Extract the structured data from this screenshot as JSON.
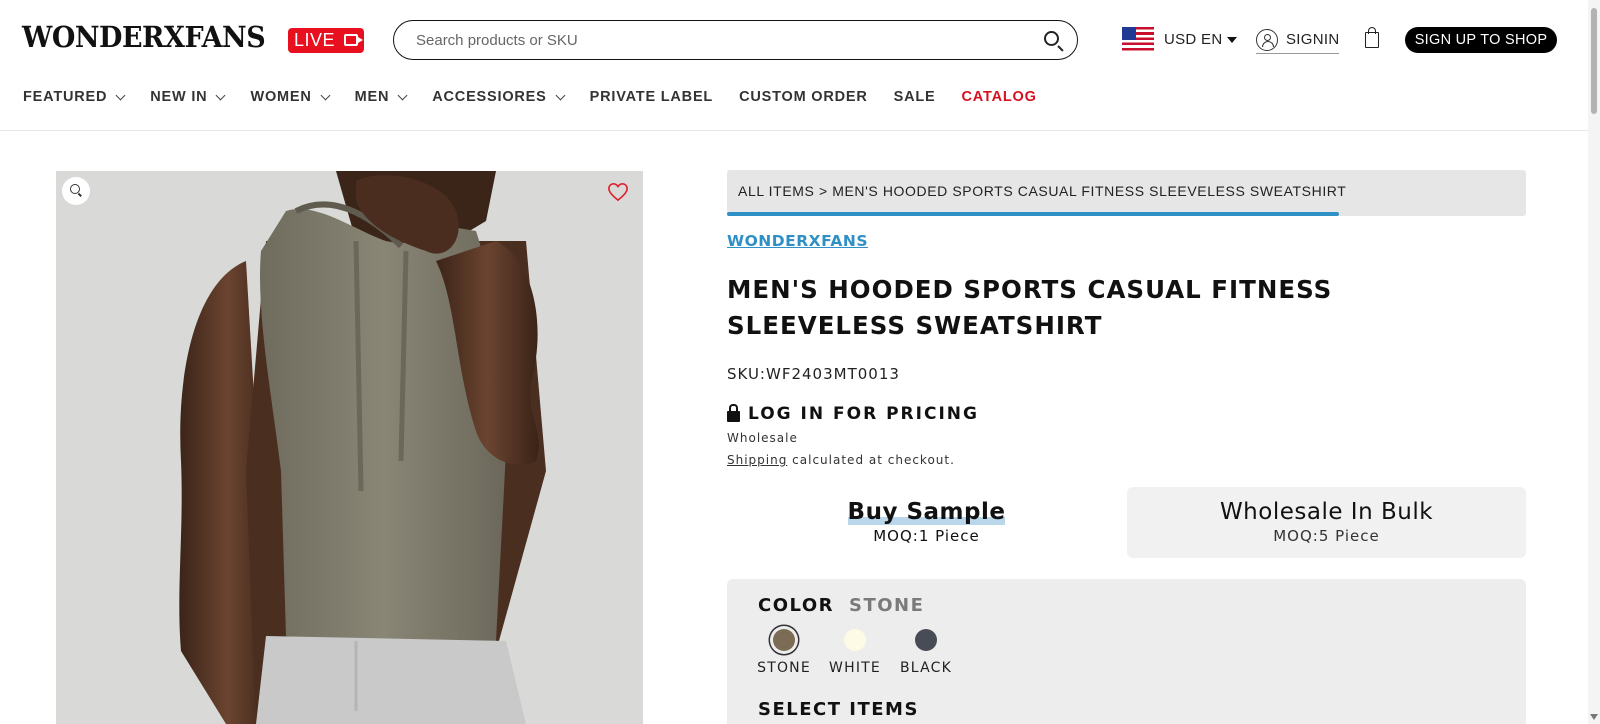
{
  "header": {
    "logo": "WONDERXFANS",
    "live_label": "LIVE",
    "search_placeholder": "Search products or SKU",
    "currency_lang": "USD EN",
    "signin_label": "SIGNIN",
    "signup_label": "SIGN UP TO SHOP"
  },
  "nav": {
    "items": [
      {
        "label": "FEATURED",
        "dropdown": true
      },
      {
        "label": "NEW IN",
        "dropdown": true
      },
      {
        "label": "WOMEN",
        "dropdown": true
      },
      {
        "label": "MEN",
        "dropdown": true
      },
      {
        "label": "ACCESSIORES",
        "dropdown": true
      },
      {
        "label": "PRIVATE LABEL",
        "dropdown": false
      },
      {
        "label": "CUSTOM ORDER",
        "dropdown": false
      },
      {
        "label": "SALE",
        "dropdown": false
      },
      {
        "label": "CATALOG",
        "dropdown": false
      }
    ],
    "catalog_color": "#d8101f"
  },
  "product": {
    "breadcrumb": "ALL ITEMS > MEN'S HOODED SPORTS CASUAL FITNESS SLEEVELESS SWEATSHIRT",
    "brand": "WONDERXFANS",
    "title": "MEN'S HOODED SPORTS CASUAL FITNESS SLEEVELESS SWEATSHIRT",
    "sku": "SKU:WF2403MT0013",
    "pricing_label": "LOG IN FOR PRICING",
    "wholesale_label": "Wholesale",
    "shipping_link": "Shipping",
    "shipping_text": " calculated at checkout.",
    "options": {
      "sample": {
        "title": "Buy Sample",
        "moq": "MOQ:1 Piece"
      },
      "bulk": {
        "title": "Wholesale In Bulk",
        "moq": "MOQ:5 Piece"
      }
    },
    "color_label": "COLOR",
    "color_selected": "STONE",
    "colors": [
      {
        "name": "STONE",
        "hex": "#7d6c55",
        "selected": true
      },
      {
        "name": "WHITE",
        "hex": "#fdfbe6",
        "selected": false
      },
      {
        "name": "BLACK",
        "hex": "#474c55",
        "selected": false
      }
    ],
    "select_items_label": "SELECT ITEMS",
    "accent_color": "#2f90c5"
  }
}
